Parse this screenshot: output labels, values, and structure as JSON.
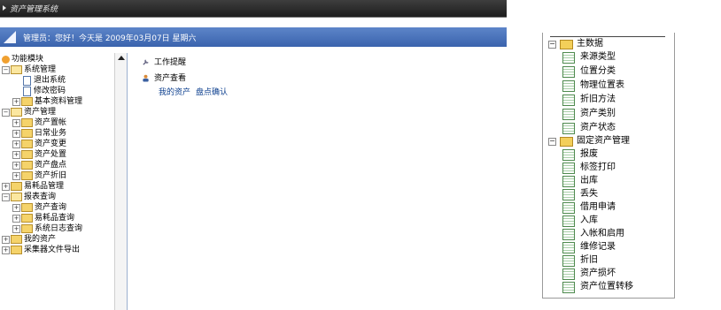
{
  "app": {
    "window_title": "资产管理系统",
    "greeting": "管理员：您好！今天是 2009年03月07日 星期六"
  },
  "sidebar": {
    "items": [
      {
        "label": "功能模块"
      },
      {
        "label": "系统管理"
      },
      {
        "label": "退出系统"
      },
      {
        "label": "修改密码"
      },
      {
        "label": "基本资料管理"
      },
      {
        "label": "资产管理"
      },
      {
        "label": "资产置帐"
      },
      {
        "label": "日常业务"
      },
      {
        "label": "资产变更"
      },
      {
        "label": "资产处置"
      },
      {
        "label": "资产盘点"
      },
      {
        "label": "资产折旧"
      },
      {
        "label": "易耗品管理"
      },
      {
        "label": "报表查询"
      },
      {
        "label": "资产查询"
      },
      {
        "label": "易耗品查询"
      },
      {
        "label": "系统日志查询"
      },
      {
        "label": "我的资产"
      },
      {
        "label": "采集器文件导出"
      }
    ]
  },
  "content": {
    "reminder_label": "工作提醒",
    "asset_view_label": "资产查看",
    "links": [
      "我的资产",
      "盘点确认"
    ]
  },
  "tree_panel": {
    "groups": [
      {
        "label": "主数据",
        "children": [
          "来源类型",
          "位置分类",
          "物理位置表",
          "折旧方法",
          "资产类别",
          "资产状态"
        ]
      },
      {
        "label": "固定资产管理",
        "children": [
          "报废",
          "标签打印",
          "出库",
          "丢失",
          "借用申请",
          "入库",
          "入帐和启用",
          "维修记录",
          "折旧",
          "资产损坏",
          "资产位置转移"
        ]
      }
    ]
  },
  "colors": {
    "title_bar": "#2a2a2a",
    "info_bar": "#4a72b8",
    "link": "#0b3e8e",
    "folder": "#f3cf5a"
  }
}
